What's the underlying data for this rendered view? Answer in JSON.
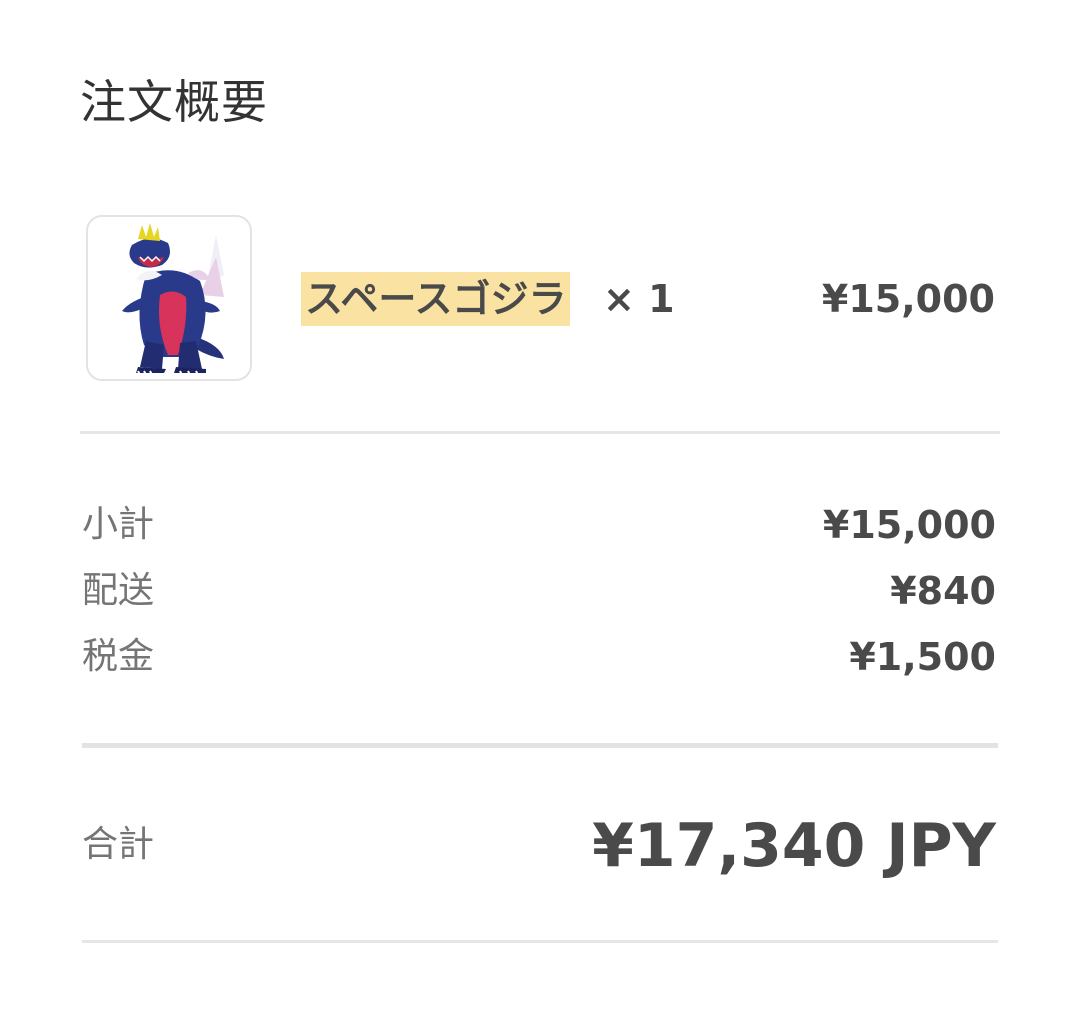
{
  "summary": {
    "title": "注文概要"
  },
  "line_item": {
    "name": "スペースゴジラ",
    "quantity": "× 1",
    "price": "¥15,000",
    "thumbnail_icon": "kaiju-figure-image"
  },
  "costs": [
    {
      "label": "小計",
      "value": "¥15,000"
    },
    {
      "label": "配送",
      "value": "¥840"
    },
    {
      "label": "税金",
      "value": "¥1,500"
    }
  ],
  "total": {
    "label": "合計",
    "value": "¥17,340 JPY"
  },
  "colors": {
    "highlight": "#fae3a2",
    "text": "#4a4a4a",
    "muted": "#757575",
    "divider": "#e6e6e6"
  }
}
